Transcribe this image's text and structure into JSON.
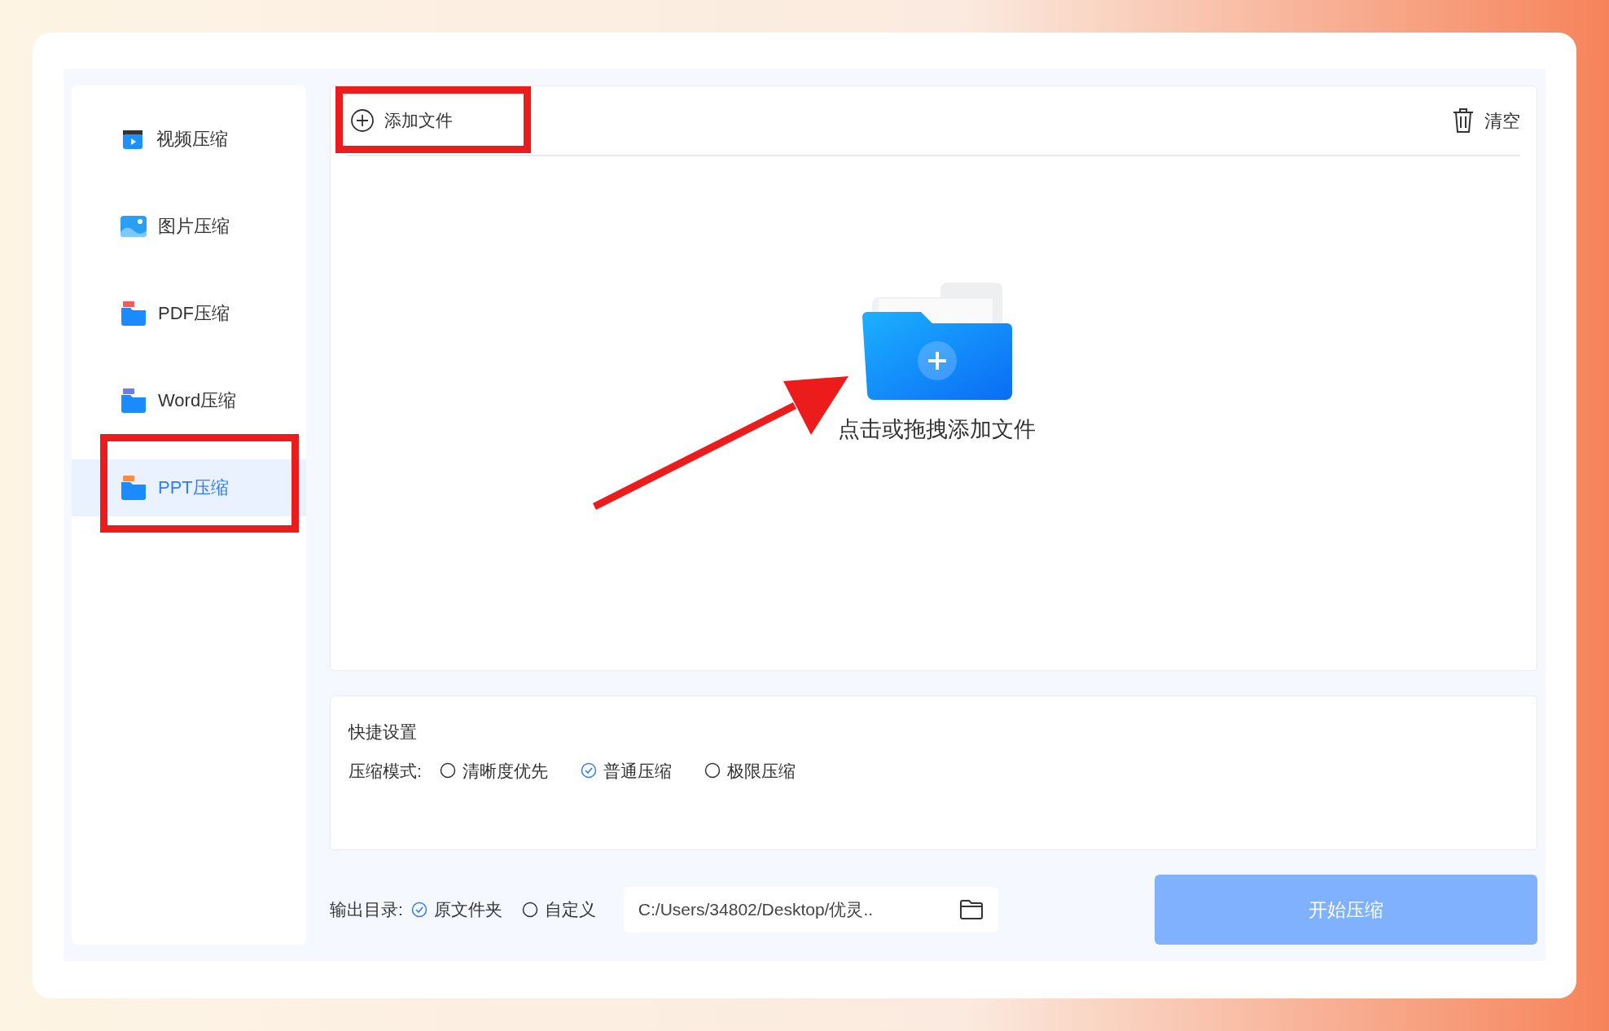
{
  "sidebar": {
    "items": [
      {
        "label": "视频压缩",
        "kind": "video",
        "selected": false,
        "annotated": false
      },
      {
        "label": "图片压缩",
        "kind": "image",
        "selected": false,
        "annotated": false
      },
      {
        "label": "PDF压缩",
        "kind": "pdf",
        "selected": false,
        "annotated": false
      },
      {
        "label": "Word压缩",
        "kind": "word",
        "selected": false,
        "annotated": false
      },
      {
        "label": "PPT压缩",
        "kind": "ppt",
        "selected": true,
        "annotated": true
      }
    ]
  },
  "toolbar": {
    "add_file": {
      "label": "添加文件",
      "annotated": true
    },
    "clear": {
      "label": "清空"
    }
  },
  "drop_zone": {
    "hint": "点击或拖拽添加文件",
    "arrow": true
  },
  "quick_settings": {
    "title": "快捷设置",
    "mode_label": "压缩模式:",
    "modes": [
      {
        "label": "清晰度优先",
        "selected": false
      },
      {
        "label": "普通压缩",
        "selected": true
      },
      {
        "label": "极限压缩",
        "selected": false
      }
    ]
  },
  "output": {
    "label": "输出目录:",
    "options": [
      {
        "label": "原文件夹",
        "selected": true
      },
      {
        "label": "自定义",
        "selected": false
      }
    ],
    "path": "C:/Users/34802/Desktop/优灵.."
  },
  "start_button": {
    "label": "开始压缩",
    "disabled": true
  }
}
